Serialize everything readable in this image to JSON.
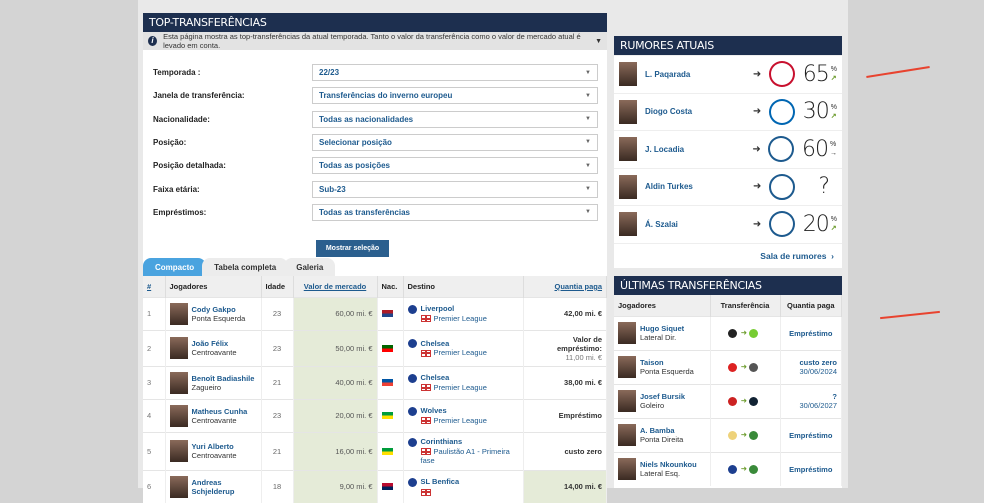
{
  "top": {
    "title": "TOP-TRANSFERÊNCIAS",
    "info": "Esta página mostra as top-transferências da atual temporada. Tanto o valor da transferência como o valor de mercado atual é levado em conta.",
    "filters": [
      {
        "label": "Temporada :",
        "value": "22/23"
      },
      {
        "label": "Janela de transferência:",
        "value": "Transferências do inverno europeu"
      },
      {
        "label": "Nacionalidade:",
        "value": "Todas as nacionalidades"
      },
      {
        "label": "Posição:",
        "value": "Selecionar posição"
      },
      {
        "label": "Posição detalhada:",
        "value": "Todas as posições"
      },
      {
        "label": "Faixa etária:",
        "value": "Sub-23"
      },
      {
        "label": "Empréstimos:",
        "value": "Todas as transferências"
      }
    ],
    "show_button": "Mostrar seleção",
    "tabs": [
      "Compacto",
      "Tabela completa",
      "Galeria"
    ],
    "columns": [
      "#",
      "Jogadores",
      "Idade",
      "Valor de mercado",
      "Nac.",
      "Destino",
      "Quantia paga"
    ],
    "rows": [
      {
        "n": "1",
        "name": "Cody Gakpo",
        "pos": "Ponta Esquerda",
        "age": "23",
        "mv": "60,00 mi. €",
        "club": "Liverpool",
        "league": "Premier League",
        "fee": "42,00 mi. €",
        "fee2": ""
      },
      {
        "n": "2",
        "name": "João Félix",
        "pos": "Centroavante",
        "age": "23",
        "mv": "50,00 mi. €",
        "club": "Chelsea",
        "league": "Premier League",
        "fee": "Valor de empréstimo:",
        "fee2": "11,00 mi. €"
      },
      {
        "n": "3",
        "name": "Benoît Badiashile",
        "pos": "Zagueiro",
        "age": "21",
        "mv": "40,00 mi. €",
        "club": "Chelsea",
        "league": "Premier League",
        "fee": "38,00 mi. €",
        "fee2": ""
      },
      {
        "n": "4",
        "name": "Matheus Cunha",
        "pos": "Centroavante",
        "age": "23",
        "mv": "20,00 mi. €",
        "club": "Wolves",
        "league": "Premier League",
        "fee": "Empréstimo",
        "fee2": ""
      },
      {
        "n": "5",
        "name": "Yuri Alberto",
        "pos": "Centroavante",
        "age": "21",
        "mv": "16,00 mi. €",
        "club": "Corinthians",
        "league": "Paulistão A1 - Primeira fase",
        "fee": "custo zero",
        "fee2": ""
      },
      {
        "n": "6",
        "name": "Andreas Schjelderup",
        "pos": "",
        "age": "18",
        "mv": "9,00 mi. €",
        "club": "SL Benfica",
        "league": "",
        "fee": "14,00 mi. €",
        "fee2": ""
      }
    ]
  },
  "rumors": {
    "title": "RUMORES ATUAIS",
    "more": "Sala de rumores",
    "items": [
      {
        "name": "L. Paqarada",
        "pct": "65",
        "unit": "%",
        "trend": "↗",
        "color": "#c8102e"
      },
      {
        "name": "Diogo Costa",
        "pct": "30",
        "unit": "%",
        "trend": "↗",
        "color": "#0066b2"
      },
      {
        "name": "J. Locadia",
        "pct": "60",
        "unit": "%",
        "trend": "→",
        "color": "#1d5a8e"
      },
      {
        "name": "Aldin Turkes",
        "pct": "?",
        "unit": "",
        "trend": "",
        "color": "#1d5a8e"
      },
      {
        "name": "Á. Szalai",
        "pct": "20",
        "unit": "%",
        "trend": "↗",
        "color": "#1d5a8e"
      }
    ]
  },
  "latest": {
    "title": "ÚLTIMAS TRANSFERÊNCIAS",
    "columns": [
      "Jogadores",
      "Transferência",
      "Quantia paga"
    ],
    "items": [
      {
        "name": "Hugo Siquet",
        "pos": "Lateral Dir.",
        "fee": "Empréstimo",
        "date": ""
      },
      {
        "name": "Taison",
        "pos": "Ponta Esquerda",
        "fee": "custo zero",
        "date": "30/06/2024"
      },
      {
        "name": "Josef Bursik",
        "pos": "Goleiro",
        "fee": "?",
        "date": "30/06/2027"
      },
      {
        "name": "A. Bamba",
        "pos": "Ponta Direita",
        "fee": "Empréstimo",
        "date": ""
      },
      {
        "name": "Niels Nkounkou",
        "pos": "Lateral Esq.",
        "fee": "Empréstimo",
        "date": ""
      }
    ]
  }
}
